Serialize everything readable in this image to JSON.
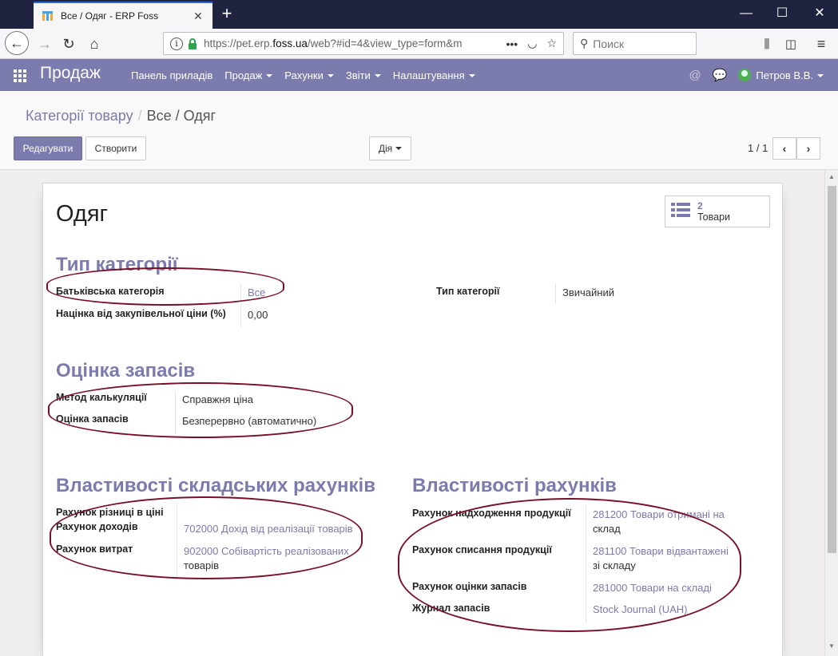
{
  "browser": {
    "tab_title": "Все / Одяг - ERP Foss",
    "url_prefix": "https://pet.erp.",
    "url_domain": "foss.ua",
    "url_rest": "/web?#id=4&view_type=form&m",
    "search_placeholder": "Поиск",
    "accent_color": "#2c66d8"
  },
  "nav": {
    "app_name": "Продаж",
    "menu": [
      {
        "label": "Панель приладів",
        "dropdown": false
      },
      {
        "label": "Продаж",
        "dropdown": true
      },
      {
        "label": "Рахунки",
        "dropdown": true
      },
      {
        "label": "Звіти",
        "dropdown": true
      },
      {
        "label": "Налаштування",
        "dropdown": true
      }
    ],
    "user": "Петров В.В.",
    "brand_color": "#7c7bad"
  },
  "control_panel": {
    "breadcrumb_parent": "Категорії товару",
    "breadcrumb_current": "Все / Одяг",
    "edit_label": "Редагувати",
    "create_label": "Створити",
    "action_label": "Дія",
    "pager": "1 / 1"
  },
  "form": {
    "title": "Одяг",
    "stat": {
      "count": "2",
      "label": "Товари"
    },
    "section_category": {
      "heading": "Тип категорії",
      "parent_label": "Батьківська категорія",
      "parent_value": "Все",
      "markup_label": "Націнка від закупівельної ціни (%)",
      "markup_value": "0,00",
      "type_label": "Тип категорії",
      "type_value": "Звичайний"
    },
    "section_valuation": {
      "heading": "Оцінка запасів",
      "costing_label": "Метод калькуляції",
      "costing_value": "Справжня ціна",
      "valuation_label": "Оцінка запасів",
      "valuation_value": "Безперервно (автоматично)"
    },
    "section_stock_accounts": {
      "heading": "Властивості складських рахунків",
      "diff_label": "Рахунок різниці в ціні",
      "income_label": "Рахунок доходів",
      "income_value": "702000 Дохід від реалізації товарів",
      "expense_label": "Рахунок витрат",
      "expense_value_link": "902000 Собівартість реалізованих",
      "expense_value_tail": "товарів"
    },
    "section_accounts": {
      "heading": "Властивості рахунків",
      "input_label": "Рахунок надходження продукції",
      "input_value_link": "281200 Товари отримані на",
      "input_value_tail": "склад",
      "output_label": "Рахунок списання продукції",
      "output_value_link": "281100 Товари відвантажені",
      "output_value_tail": "зі складу",
      "valuation_label": "Рахунок оцінки запасів",
      "valuation_value": "281000 Товари на складі",
      "journal_label": "Журнал запасів",
      "journal_value": "Stock Journal (UAH)"
    }
  },
  "annotation_color": "#7a0f2a"
}
